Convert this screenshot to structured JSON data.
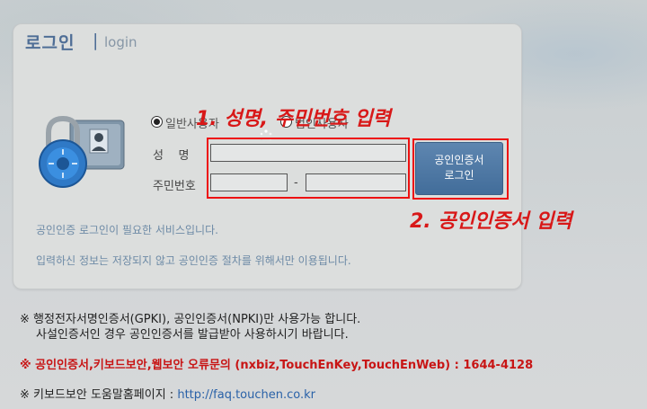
{
  "header": {
    "title": "로그인",
    "separator": "|",
    "subtitle": "login"
  },
  "user_type": {
    "general": "일반사용자",
    "corporate": "법인사용자",
    "selected": "일반사용자"
  },
  "form": {
    "name_label": "성    명",
    "name_value": "",
    "rrn_label": "주민번호",
    "rrn_first_value": "",
    "rrn_second_value": "",
    "rrn_separator": "-"
  },
  "cert_button": {
    "line1": "공인인증서",
    "line2": "로그인"
  },
  "annotations": {
    "step1": "1. 성명, 주민번호 입력",
    "step2": "2. 공인인증서 입력",
    "color": "#e01414"
  },
  "info": {
    "line1": "공인인증 로그인이 필요한 서비스입니다.",
    "line2": "입력하신 정보는 저장되지 않고 공인인증 절차를 위해서만 이용됩니다."
  },
  "notes": {
    "note1_line1": "※ 행정전자서명인증서(GPKI), 공인인증서(NPKI)만 사용가능 합니다.",
    "note1_line2": "사설인증서인 경우 공인인증서를 발급받아 사용하시기 바랍니다.",
    "note2": "※ 공인인증서,키보드보안,웹보안 오류문의 (nxbiz,TouchEnKey,TouchEnWeb) : 1644-4128",
    "note3_prefix": "※ 키보드보안 도움말홈페이지 : ",
    "note3_link": "http://faq.touchen.co.kr"
  },
  "colors": {
    "title": "#4f6e96",
    "info_text": "#6d8aa6",
    "button": "#4a74a1",
    "warning": "#c81515",
    "link": "#2a62a8"
  },
  "icons": {
    "lock": "padlock-folder-icon",
    "loading": "loading-spinner-icon"
  }
}
